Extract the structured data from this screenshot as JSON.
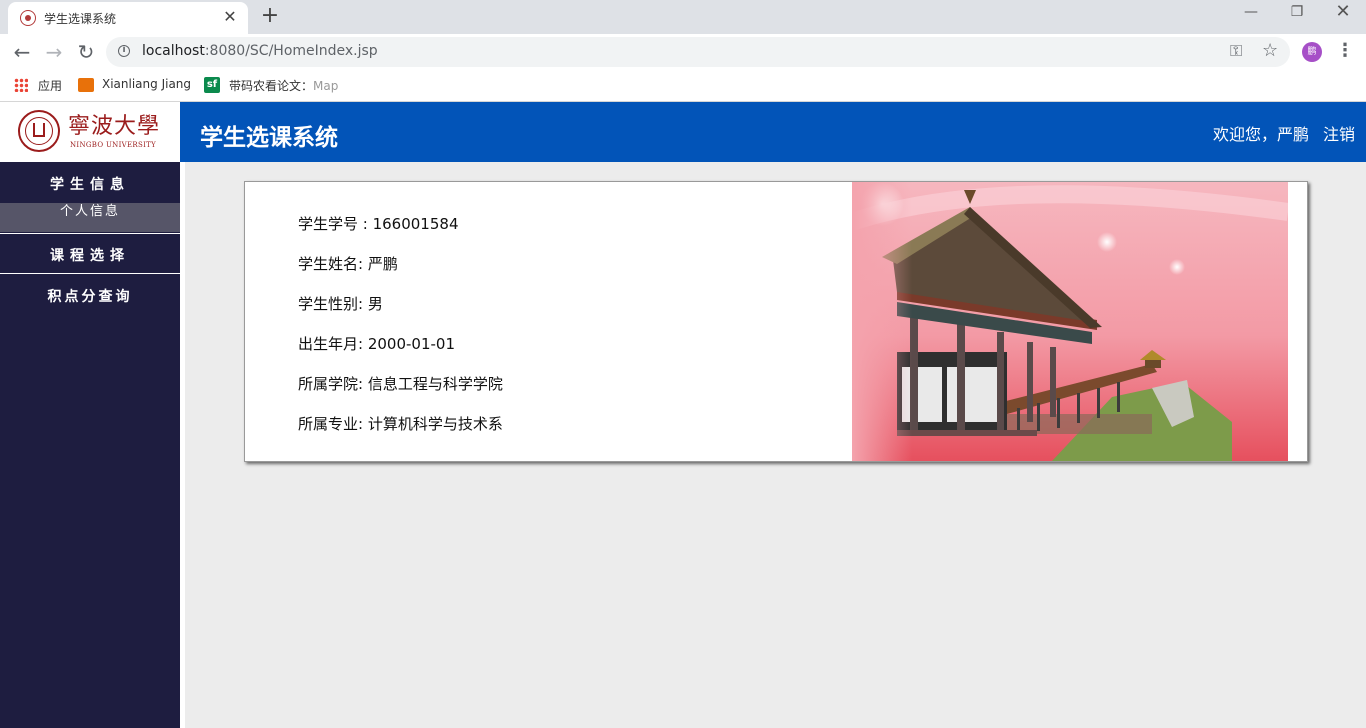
{
  "browser": {
    "tab_title": "学生选课系统",
    "url_host": "localhost",
    "url_rest": ":8080/SC/HomeIndex.jsp",
    "profile_initial": "鹏",
    "bookmarks": {
      "apps": "应用",
      "xj": "Xianliang Jiang",
      "sf": "带码农看论文：",
      "sf_fade": "Map"
    }
  },
  "header": {
    "logo_cn": "寧波大學",
    "logo_en": "NINGBO UNIVERSITY",
    "title": "学生选课系统",
    "welcome": "欢迎您，严鹏",
    "logout": "注销"
  },
  "sidebar": {
    "sections": [
      {
        "label": "学生信息",
        "items": [
          "个人信息"
        ]
      },
      {
        "label": "课程选择",
        "items": []
      },
      {
        "label": "积点分查询",
        "items": []
      }
    ]
  },
  "student": {
    "id": "学生学号 : 166001584",
    "name": "学生姓名: 严鹏",
    "gender": "学生性别: 男",
    "birth": "出生年月: 2000-01-01",
    "college": "所属学院: 信息工程与科学学院",
    "major": "所属专业: 计算机科学与技术系"
  },
  "colors": {
    "header_bg": "#0254b8",
    "sidebar_bg": "#1e1d40",
    "content_bg": "#ececec",
    "brand_red": "#9b1c1c"
  }
}
